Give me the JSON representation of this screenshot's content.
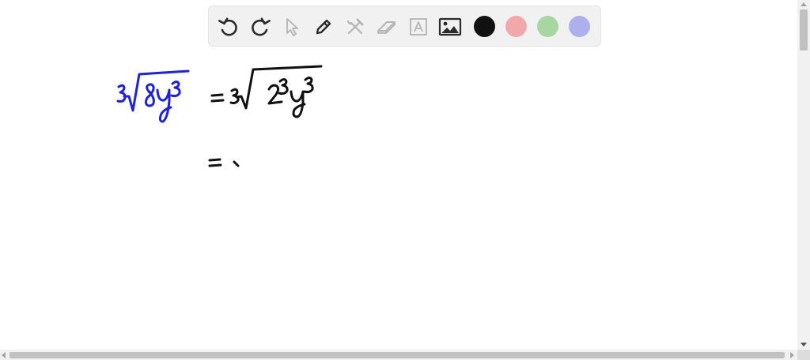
{
  "toolbar": {
    "tools": [
      {
        "name": "undo-button",
        "icon": "undo-icon"
      },
      {
        "name": "redo-button",
        "icon": "redo-icon"
      },
      {
        "name": "select-button",
        "icon": "pointer-icon"
      },
      {
        "name": "pen-button",
        "icon": "pencil-icon"
      },
      {
        "name": "tools-button",
        "icon": "hammer-wrench-icon"
      },
      {
        "name": "eraser-button",
        "icon": "eraser-icon"
      },
      {
        "name": "text-button",
        "icon": "text-a-icon"
      },
      {
        "name": "image-button",
        "icon": "image-icon"
      }
    ],
    "colors": {
      "black": "#111111",
      "red": "#f0a8aa",
      "green": "#a7d6a2",
      "blue": "#aeb0ee"
    }
  },
  "ink": {
    "blue": "#1f22d8",
    "black": "#111111"
  }
}
